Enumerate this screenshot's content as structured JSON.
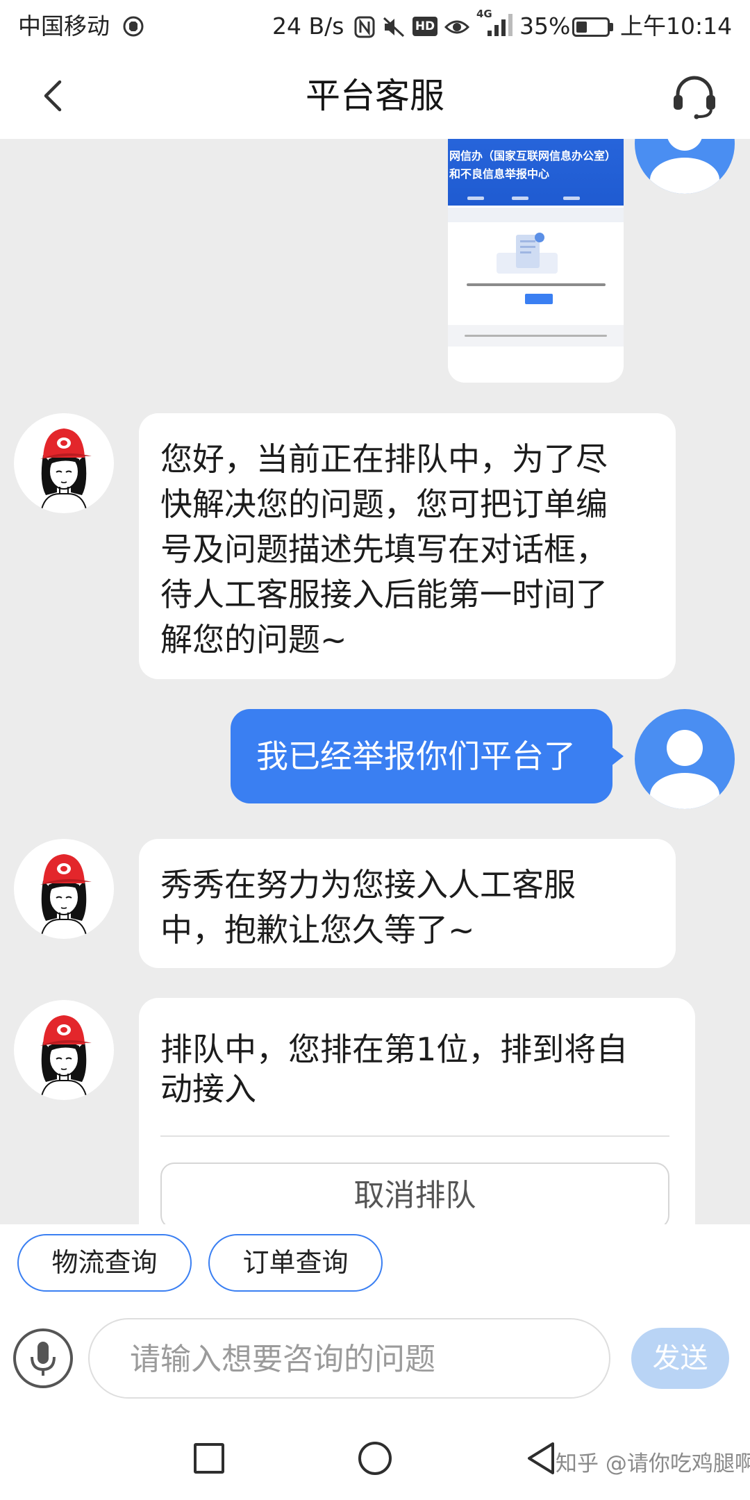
{
  "status_bar": {
    "carrier": "中国移动",
    "net_speed": "24 B/s",
    "hd_badge": "HD",
    "network_type": "4G",
    "battery_percent": "35%",
    "battery_level": 0.35,
    "time": "上午10:14",
    "icons": [
      "status-app-icon",
      "nfc-icon",
      "mute-icon",
      "eye-icon",
      "signal-icon",
      "battery-icon"
    ]
  },
  "header": {
    "title": "平台客服",
    "back_icon": "chevron-left-icon",
    "service_icon": "headset-icon"
  },
  "chat": {
    "image_message": {
      "headline_1": "网信办（国家互联网信息办公室）",
      "headline_2": "和不良信息举报中心"
    },
    "bot_message_1": {
      "lines": [
        "您好，当前正在排队中，为了尽",
        "快解决您的问题，您可把订单编",
        "号及问题描述先填写在对话框，",
        "待人工客服接入后能第一时间了",
        "解您的问题~"
      ]
    },
    "user_message_1": {
      "text": "我已经举报你们平台了"
    },
    "bot_message_2": {
      "lines": [
        "秀秀在努力为您接入人工客服",
        "中，抱歉让您久等了~"
      ]
    },
    "bot_message_3": {
      "lines": [
        "排队中，您排在第1位，排到将自",
        "动接入"
      ],
      "cancel_button": "取消排队"
    }
  },
  "quick_actions": [
    {
      "label": "物流查询"
    },
    {
      "label": "订单查询"
    }
  ],
  "composer": {
    "placeholder": "请输入想要咨询的问题",
    "send_label": "发送",
    "mic_icon": "microphone-icon"
  },
  "nav_bar": {
    "icons": [
      "recent-apps-icon",
      "home-icon",
      "back-triangle-icon"
    ]
  },
  "watermark": "知乎 @请你吃鸡腿啊",
  "colors": {
    "accent": "#3a7ff2",
    "send_disabled": "#b9d4f5",
    "chat_background": "#ececec",
    "user_bubble": "#3a7ff2",
    "bot_cap_red": "#e3262b"
  }
}
